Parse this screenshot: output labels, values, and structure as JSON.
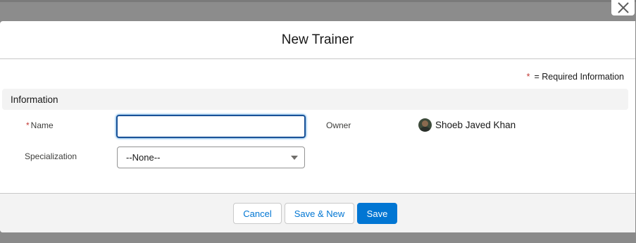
{
  "modal": {
    "title": "New Trainer",
    "close_icon": "close-icon"
  },
  "required_info": {
    "star": "*",
    "text": "= Required Information"
  },
  "section": {
    "title": "Information"
  },
  "fields": {
    "name": {
      "required_star": "*",
      "label": "Name",
      "value": ""
    },
    "specialization": {
      "label": "Specialization",
      "selected": "--None--"
    },
    "owner": {
      "label": "Owner",
      "value": "Shoeb Javed Khan"
    }
  },
  "footer": {
    "cancel_label": "Cancel",
    "save_new_label": "Save & New",
    "save_label": "Save"
  },
  "colors": {
    "brand": "#0176d3",
    "required": "#c23934",
    "focus_border": "#1b5297"
  }
}
